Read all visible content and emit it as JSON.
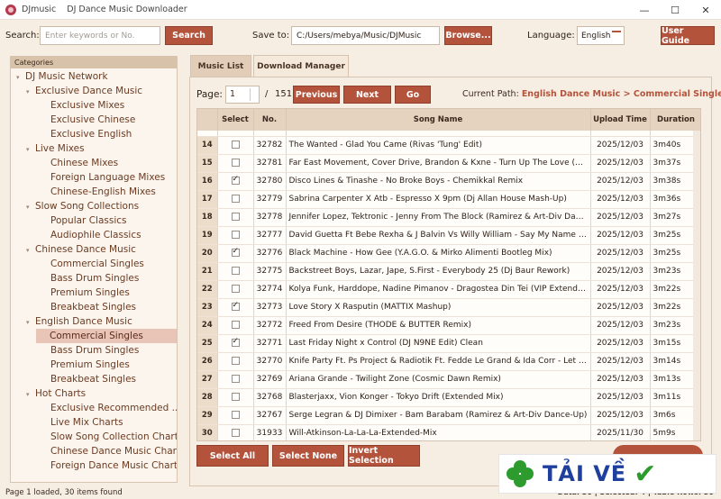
{
  "window": {
    "title": "DJmusic    DJ Dance Music Downloader",
    "min": "—",
    "max": "☐",
    "close": "✕"
  },
  "toolbar": {
    "search_label": "Search:",
    "search_placeholder": "Enter keywords or No.",
    "search_button": "Search",
    "save_label": "Save to:",
    "save_path": "C:/Users/mebya/Music/DJMusic",
    "browse_button": "Browse...",
    "language_label": "Language:",
    "language_value": "English",
    "guide_button": "User Guide"
  },
  "sidebar": {
    "header": "Categories",
    "items": [
      {
        "label": "DJ Music Network",
        "level": 0,
        "caret": "▾"
      },
      {
        "label": "Exclusive Dance Music",
        "level": 1,
        "caret": "▾"
      },
      {
        "label": "Exclusive Mixes",
        "level": 2
      },
      {
        "label": "Exclusive Chinese",
        "level": 2
      },
      {
        "label": "Exclusive English",
        "level": 2
      },
      {
        "label": "Live Mixes",
        "level": 1,
        "caret": "▾"
      },
      {
        "label": "Chinese Mixes",
        "level": 2
      },
      {
        "label": "Foreign Language Mixes",
        "level": 2
      },
      {
        "label": "Chinese-English Mixes",
        "level": 2
      },
      {
        "label": "Slow Song Collections",
        "level": 1,
        "caret": "▾"
      },
      {
        "label": "Popular Classics",
        "level": 2
      },
      {
        "label": "Audiophile Classics",
        "level": 2
      },
      {
        "label": "Chinese Dance Music",
        "level": 1,
        "caret": "▾"
      },
      {
        "label": "Commercial Singles",
        "level": 2
      },
      {
        "label": "Bass Drum Singles",
        "level": 2
      },
      {
        "label": "Premium Singles",
        "level": 2
      },
      {
        "label": "Breakbeat Singles",
        "level": 2
      },
      {
        "label": "English Dance Music",
        "level": 1,
        "caret": "▾"
      },
      {
        "label": "Commercial Singles",
        "level": 2,
        "selected": true
      },
      {
        "label": "Bass Drum Singles",
        "level": 2
      },
      {
        "label": "Premium Singles",
        "level": 2
      },
      {
        "label": "Breakbeat Singles",
        "level": 2
      },
      {
        "label": "Hot Charts",
        "level": 1,
        "caret": "▾"
      },
      {
        "label": "Exclusive Recommended ...",
        "level": 2
      },
      {
        "label": "Live Mix Charts",
        "level": 2
      },
      {
        "label": "Slow Song Collection Charts",
        "level": 2
      },
      {
        "label": "Chinese Dance Music Charts",
        "level": 2
      },
      {
        "label": "Foreign Dance Music Charts",
        "level": 2
      }
    ]
  },
  "tabs": [
    {
      "label": "Music List",
      "active": true
    },
    {
      "label": "Download Manager",
      "active": false
    }
  ],
  "pagination": {
    "page_label": "Page:",
    "page_value": "1",
    "separator": "/",
    "total_pages": "151",
    "prev": "Previous",
    "next": "Next",
    "go": "Go",
    "path_label": "Current Path:",
    "path_value": "English Dance Music > Commercial Singles"
  },
  "table": {
    "headers": [
      "",
      "Select",
      "No.",
      "Song Name",
      "Upload Time",
      "Duration"
    ],
    "rows": [
      {
        "idx": "14",
        "checked": false,
        "no": "32782",
        "name": "The Wanted - Glad You Came   (Rivas 'Tung' Edit)",
        "time": "2025/12/03",
        "dur": "3m40s"
      },
      {
        "idx": "15",
        "checked": false,
        "no": "32781",
        "name": "Far East Movement, Cover Drive, Brandon & Kxne - Turn Up The Love   (Art-...",
        "time": "2025/12/03",
        "dur": "3m37s"
      },
      {
        "idx": "16",
        "checked": true,
        "no": "32780",
        "name": "Disco Lines & Tinashe - No Broke Boys - Chemikkal Remix",
        "time": "2025/12/03",
        "dur": "3m38s"
      },
      {
        "idx": "17",
        "checked": false,
        "no": "32779",
        "name": "Sabrina Carpenter X Atb - Espresso X 9pm   (Dj Allan House Mash-Up)",
        "time": "2025/12/03",
        "dur": "3m36s"
      },
      {
        "idx": "18",
        "checked": false,
        "no": "32778",
        "name": "Jennifer Lopez, Tektronic - Jenny From The Block   (Ramirez & Art-Div Dance-...",
        "time": "2025/12/03",
        "dur": "3m27s"
      },
      {
        "idx": "19",
        "checked": false,
        "no": "32777",
        "name": "David Guetta Ft Bebe Rexha & J Balvin Vs Willy William - Say My Name X La L...",
        "time": "2025/12/03",
        "dur": "3m25s"
      },
      {
        "idx": "20",
        "checked": true,
        "no": "32776",
        "name": "Black Machine - How Gee   (Y.A.G.O. & Mirko Alimenti Bootleg Mix)",
        "time": "2025/12/03",
        "dur": "3m25s"
      },
      {
        "idx": "21",
        "checked": false,
        "no": "32775",
        "name": "Backstreet Boys, Lazar, Jape, S.First - Everybody 25   (Dj Baur Rework)",
        "time": "2025/12/03",
        "dur": "3m23s"
      },
      {
        "idx": "22",
        "checked": false,
        "no": "32774",
        "name": "Kolya Funk, Harddope, Nadine Pimanov - Dragostea Din Tei   (VIP Extended ...",
        "time": "2025/12/03",
        "dur": "3m22s"
      },
      {
        "idx": "23",
        "checked": true,
        "no": "32773",
        "name": "Love Story X Rasputin   (MATTIX Mashup)",
        "time": "2025/12/03",
        "dur": "3m22s"
      },
      {
        "idx": "24",
        "checked": false,
        "no": "32772",
        "name": "Freed From Desire   (THODE & BUTTER Remix)",
        "time": "2025/12/03",
        "dur": "3m23s"
      },
      {
        "idx": "25",
        "checked": true,
        "no": "32771",
        "name": "Last Friday Night x Control   (DJ N9NE Edit)   Clean",
        "time": "2025/12/03",
        "dur": "3m15s"
      },
      {
        "idx": "26",
        "checked": false,
        "no": "32770",
        "name": "Knife Party Ft. Ps Project & Radiotik Ft. Fedde Le Grand & Ida Corr - Let Me ...",
        "time": "2025/12/03",
        "dur": "3m14s"
      },
      {
        "idx": "27",
        "checked": false,
        "no": "32769",
        "name": "Ariana Grande - Twilight Zone   (Cosmic Dawn Remix)",
        "time": "2025/12/03",
        "dur": "3m13s"
      },
      {
        "idx": "28",
        "checked": false,
        "no": "32768",
        "name": "Blasterjaxx, Vion Konger - Tokyo Drift   (Extended Mix)",
        "time": "2025/12/03",
        "dur": "3m11s"
      },
      {
        "idx": "29",
        "checked": false,
        "no": "32767",
        "name": "Serge Legran & DJ Dimixer - Bam Barabam   (Ramirez & Art-Div Dance-Up)",
        "time": "2025/12/03",
        "dur": "3m6s"
      },
      {
        "idx": "30",
        "checked": false,
        "no": "31933",
        "name": "Will-Atkinson-La-La-La-Extended-Mix",
        "time": "2025/11/30",
        "dur": "5m9s"
      }
    ]
  },
  "actions": {
    "select_all": "Select All",
    "select_none": "Select None",
    "invert": "Invert Selection"
  },
  "status": {
    "left": "Page 1 loaded, 30 items found",
    "right": "Data: 30 | Selected: 4 | Table Rows: 30"
  },
  "watermark": {
    "text": "TẢI VỀ",
    "check": "✔"
  }
}
